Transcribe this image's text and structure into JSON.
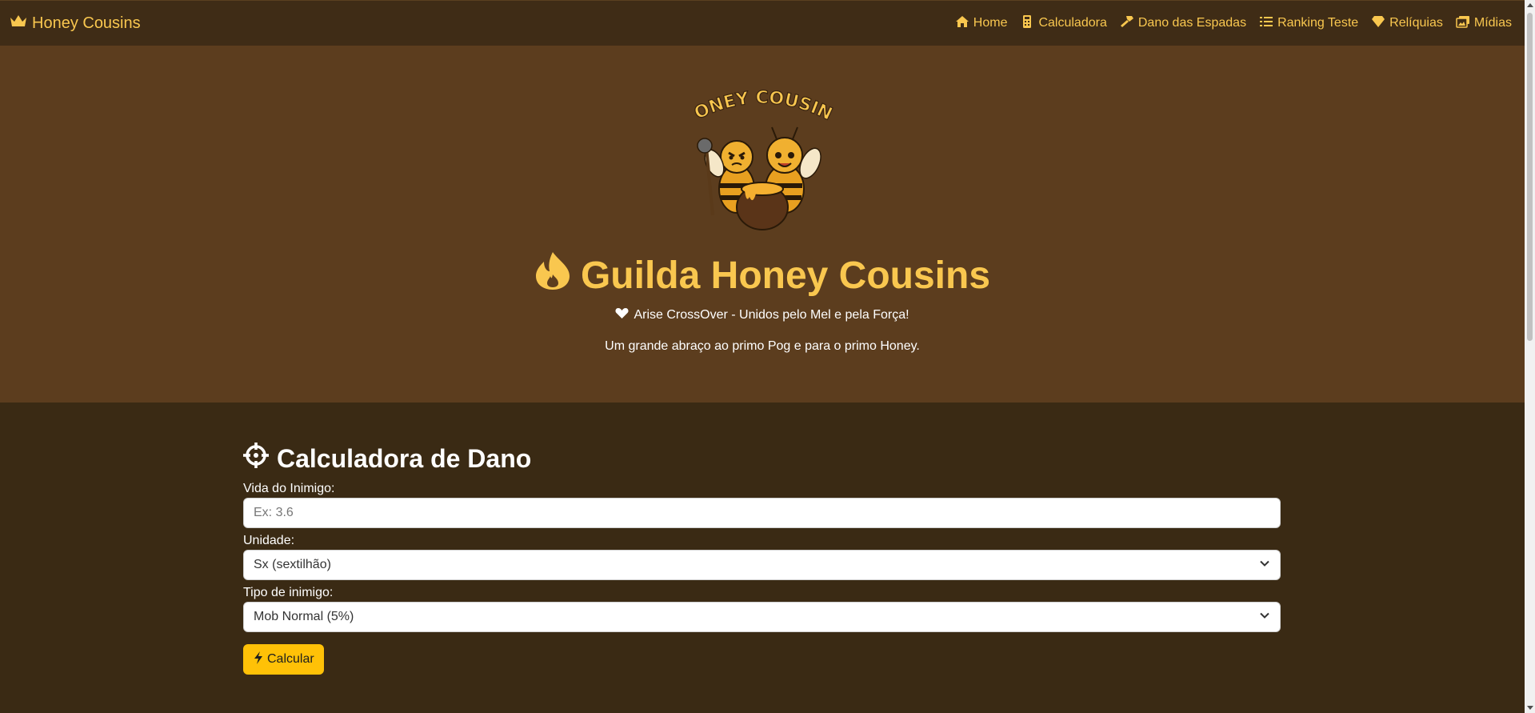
{
  "brand": {
    "name": "Honey Cousins",
    "icon": "crown-icon"
  },
  "nav": {
    "items": [
      {
        "label": "Home",
        "icon": "home-icon"
      },
      {
        "label": "Calculadora",
        "icon": "calculator-icon"
      },
      {
        "label": "Dano das Espadas",
        "icon": "hammer-icon"
      },
      {
        "label": "Ranking Teste",
        "icon": "list-icon"
      },
      {
        "label": "Relíquias",
        "icon": "gem-icon"
      },
      {
        "label": "Mídias",
        "icon": "images-icon"
      }
    ]
  },
  "hero": {
    "logo_text": "HONEY COUSINS",
    "title": "Guilda Honey Cousins",
    "subtitle": "Arise CrossOver - Unidos pelo Mel e pela Força!",
    "note": "Um grande abraço ao primo Pog e para o primo Honey."
  },
  "calculator": {
    "title": "Calculadora de Dano",
    "life_label": "Vida do Inimigo:",
    "life_placeholder": "Ex: 3.6",
    "unit_label": "Unidade:",
    "unit_value": "Sx (sextilhão)",
    "enemy_label": "Tipo de inimigo:",
    "enemy_value": "Mob Normal (5%)",
    "button_label": "Calcular"
  },
  "colors": {
    "accent": "#f9c74f",
    "navbar": "#3f2c16",
    "hero_bg": "#5c3d1e",
    "page_bg": "#3a2a14",
    "button": "#ffc107"
  }
}
